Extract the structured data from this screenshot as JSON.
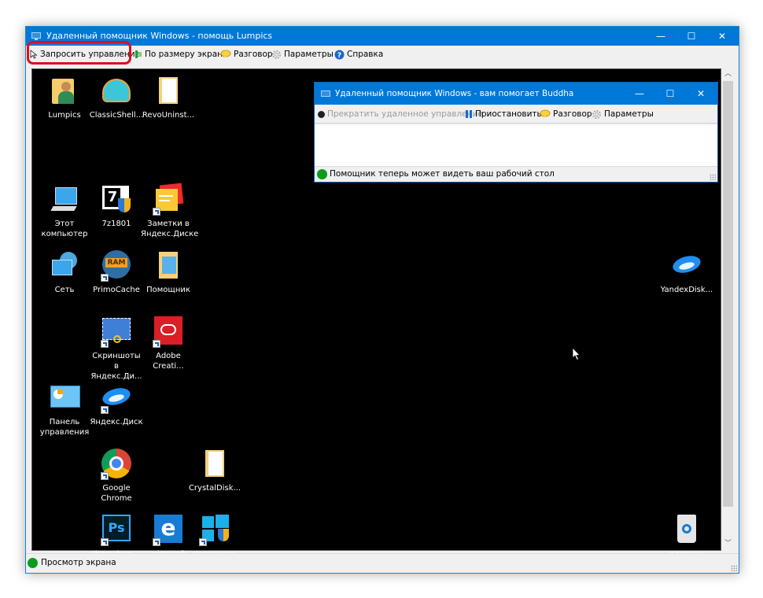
{
  "window": {
    "title": "Удаленный помощник Windows - помощь Lumpics",
    "controls": {
      "minimize": "—",
      "maximize": "☐",
      "close": "✕"
    },
    "toolbar": {
      "request_control": "Запросить управление",
      "fit_to_screen": "По размеру экрана",
      "chat": "Разговор",
      "settings": "Параметры",
      "help": "Справка"
    },
    "status": "Просмотр экрана"
  },
  "inner_window": {
    "title": "Удаленный помощник Windows - вам помогает Buddha",
    "controls": {
      "minimize": "—",
      "maximize": "☐",
      "close": "✕"
    },
    "toolbar": {
      "stop_control": "Прекратить удаленное управление",
      "pause": "Приостановить",
      "chat": "Разговор",
      "settings": "Параметры"
    },
    "status": "Помощник теперь может видеть ваш рабочий стол"
  },
  "desktop_icons": [
    {
      "label": "Lumpics",
      "icon": "user-folder-icon"
    },
    {
      "label": "ClassicShell...",
      "icon": "shell-icon"
    },
    {
      "label": "RevoUninst...",
      "icon": "folder-icon"
    },
    {
      "label": "Этот компьютер",
      "icon": "computer-icon"
    },
    {
      "label": "7z1801",
      "icon": "7zip-installer-icon"
    },
    {
      "label": "Заметки в Яндекс.Диске",
      "icon": "notes-icon"
    },
    {
      "label": "Сеть",
      "icon": "network-icon"
    },
    {
      "label": "PrimoCache",
      "icon": "ram-icon"
    },
    {
      "label": "Помощник",
      "icon": "folder-icon"
    },
    {
      "label": "Скриншоты в Яндекс.Ди...",
      "icon": "screenshot-icon"
    },
    {
      "label": "Adobe Creati...",
      "icon": "creative-cloud-icon"
    },
    {
      "label": "Панель управления",
      "icon": "control-panel-icon"
    },
    {
      "label": "Яндекс.Диск",
      "icon": "yandex-disk-icon"
    },
    {
      "label": "Google Chrome",
      "icon": "chrome-icon"
    },
    {
      "label": "CrystalDisk...",
      "icon": "folder-icon"
    },
    {
      "label": "Photoshop — ярлык",
      "icon": "photoshop-icon"
    },
    {
      "label": "Microsoft Edge",
      "icon": "edge-icon"
    },
    {
      "label": "Помощник по обновл...",
      "icon": "windows-update-icon"
    },
    {
      "label": "YandexDisk...",
      "icon": "yandex-disk-icon"
    },
    {
      "label": "Корзина",
      "icon": "recycle-bin-icon"
    }
  ],
  "colors": {
    "accent": "#0078d7",
    "highlight": "#d6121f",
    "status_green": "#0c9c1d"
  }
}
